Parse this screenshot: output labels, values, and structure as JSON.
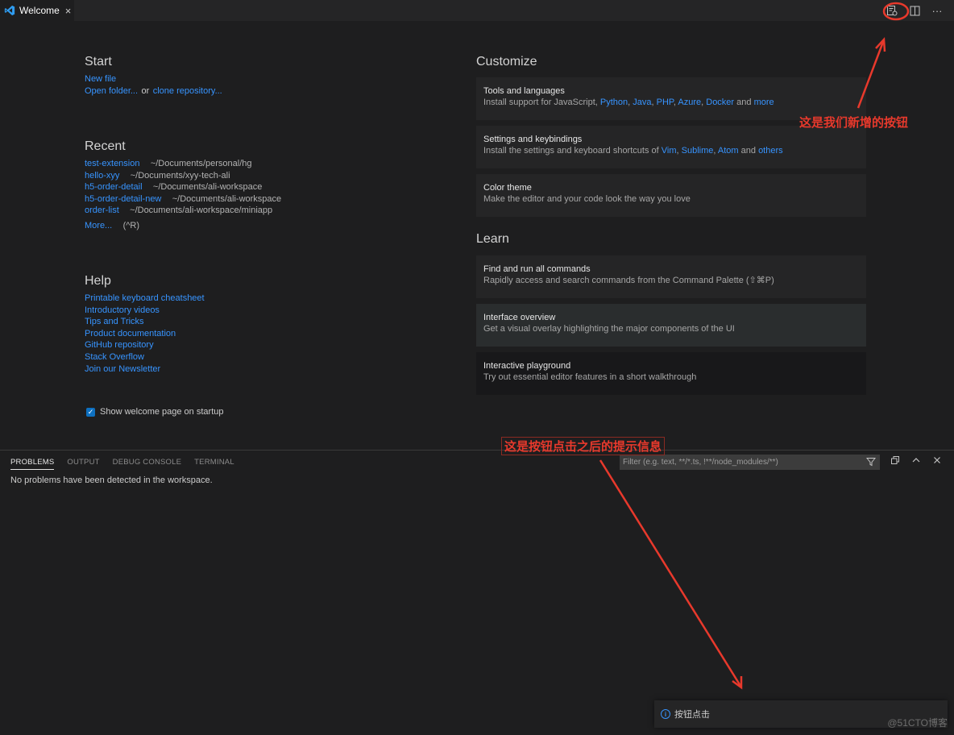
{
  "tab": {
    "title": "Welcome",
    "close": "×"
  },
  "editor_actions": {
    "new_button": "custom-button-icon",
    "split": "split-editor-icon",
    "more": "···"
  },
  "start": {
    "title": "Start",
    "new_file": "New file",
    "open_folder": "Open folder...",
    "or": "or",
    "clone": "clone repository..."
  },
  "recent": {
    "title": "Recent",
    "items": [
      {
        "name": "test-extension",
        "path": "~/Documents/personal/hg"
      },
      {
        "name": "hello-xyy",
        "path": "~/Documents/xyy-tech-ali"
      },
      {
        "name": "h5-order-detail",
        "path": "~/Documents/ali-workspace"
      },
      {
        "name": "h5-order-detail-new",
        "path": "~/Documents/ali-workspace"
      },
      {
        "name": "order-list",
        "path": "~/Documents/ali-workspace/miniapp"
      }
    ],
    "more": "More...",
    "more_shortcut": "(^R)"
  },
  "help": {
    "title": "Help",
    "links": [
      "Printable keyboard cheatsheet",
      "Introductory videos",
      "Tips and Tricks",
      "Product documentation",
      "GitHub repository",
      "Stack Overflow",
      "Join our Newsletter"
    ]
  },
  "startup": {
    "label": "Show welcome page on startup",
    "checked": true
  },
  "customize": {
    "title": "Customize",
    "tools": {
      "title": "Tools and languages",
      "prefix": "Install support for JavaScript,",
      "python": "Python",
      "java": "Java",
      "php": "PHP",
      "azure": "Azure",
      "docker": "Docker",
      "and": "and",
      "more": "more"
    },
    "settings": {
      "title": "Settings and keybindings",
      "prefix": "Install the settings and keyboard shortcuts of",
      "vim": "Vim",
      "sublime": "Sublime",
      "atom": "Atom",
      "and": "and",
      "others": "others"
    },
    "theme": {
      "title": "Color theme",
      "desc": "Make the editor and your code look the way you love"
    }
  },
  "learn": {
    "title": "Learn",
    "cards": [
      {
        "title": "Find and run all commands",
        "desc": "Rapidly access and search commands from the Command Palette (⇧⌘P)"
      },
      {
        "title": "Interface overview",
        "desc": "Get a visual overlay highlighting the major components of the UI"
      },
      {
        "title": "Interactive playground",
        "desc": "Try out essential editor features in a short walkthrough"
      }
    ]
  },
  "panel": {
    "tabs": [
      "PROBLEMS",
      "OUTPUT",
      "DEBUG CONSOLE",
      "TERMINAL"
    ],
    "active_tab": "PROBLEMS",
    "message": "No problems have been detected in the workspace.",
    "filter_placeholder": "Filter (e.g. text, **/*.ts, !**/node_modules/**)"
  },
  "notification": {
    "icon": "i",
    "message": "按钮点击"
  },
  "annotations": {
    "new_button": "这是我们新增的按钮",
    "notification": "这是按钮点击之后的提示信息"
  },
  "watermark": "@51CTO博客",
  "colors": {
    "link": "#3794ff",
    "annotation": "#e8392c",
    "background": "#1e1e1f"
  }
}
